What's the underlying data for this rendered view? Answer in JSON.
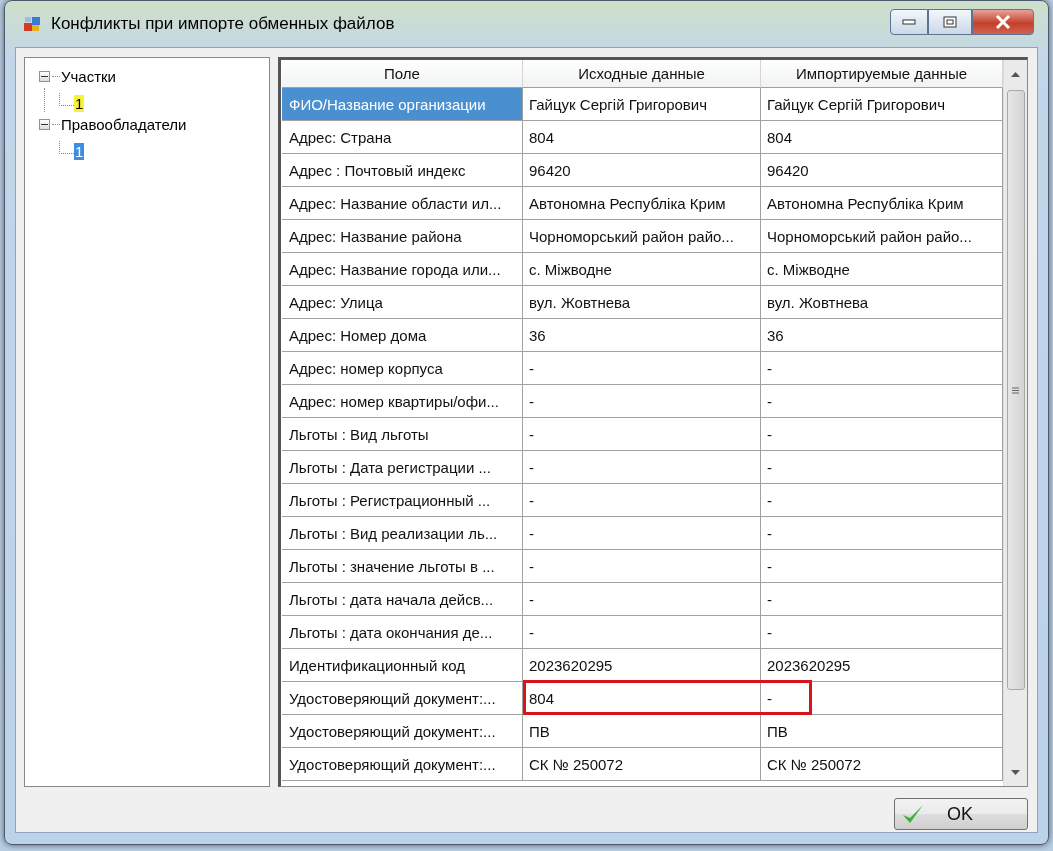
{
  "window": {
    "title": "Конфликты при импорте обменных файлов"
  },
  "tree": [
    {
      "label": "Участки",
      "expanded": true,
      "children": [
        {
          "label": "1",
          "selected": false,
          "highlighted": true
        }
      ]
    },
    {
      "label": "Правообладатели",
      "expanded": true,
      "children": [
        {
          "label": "1",
          "selected": true,
          "highlighted": false
        }
      ]
    }
  ],
  "table": {
    "columns": [
      "Поле",
      "Исходные данные",
      "Импортируемые данные"
    ],
    "rows": [
      {
        "cells": [
          "ФИО/Название организации",
          "Гайцук Сергій Григорович",
          "Гайцук Сергій Григорович"
        ],
        "selected": true,
        "highlighted": false
      },
      {
        "cells": [
          "Адрес: Страна",
          "804",
          "804"
        ],
        "selected": false,
        "highlighted": false
      },
      {
        "cells": [
          "Адрес : Почтовый индекс",
          "96420",
          "96420"
        ],
        "selected": false,
        "highlighted": false
      },
      {
        "cells": [
          "Адрес: Название области ил...",
          "Автономна Республіка Крим",
          "Автономна Республіка Крим"
        ],
        "selected": false,
        "highlighted": false
      },
      {
        "cells": [
          "Адрес: Название района",
          "Чорноморський район райо...",
          "Чорноморський район райо..."
        ],
        "selected": false,
        "highlighted": false
      },
      {
        "cells": [
          "Адрес: Название города или...",
          "с. Міжводне",
          "с. Міжводне"
        ],
        "selected": false,
        "highlighted": false
      },
      {
        "cells": [
          "Адрес: Улица",
          "вул. Жовтнева",
          "вул. Жовтнева"
        ],
        "selected": false,
        "highlighted": false
      },
      {
        "cells": [
          "Адрес: Номер дома",
          "36",
          "36"
        ],
        "selected": false,
        "highlighted": false
      },
      {
        "cells": [
          "Адрес: номер корпуса",
          "-",
          "-"
        ],
        "selected": false,
        "highlighted": false
      },
      {
        "cells": [
          "Адрес: номер квартиры/офи...",
          "-",
          "-"
        ],
        "selected": false,
        "highlighted": false
      },
      {
        "cells": [
          "Льготы : Вид льготы",
          "-",
          "-"
        ],
        "selected": false,
        "highlighted": false
      },
      {
        "cells": [
          "Льготы : Дата регистрации ...",
          "-",
          "-"
        ],
        "selected": false,
        "highlighted": false
      },
      {
        "cells": [
          "Льготы : Регистрационный ...",
          "-",
          "-"
        ],
        "selected": false,
        "highlighted": false
      },
      {
        "cells": [
          "Льготы : Вид реализации ль...",
          "-",
          "-"
        ],
        "selected": false,
        "highlighted": false
      },
      {
        "cells": [
          "Льготы : значение льготы в ...",
          "-",
          "-"
        ],
        "selected": false,
        "highlighted": false
      },
      {
        "cells": [
          "Льготы : дата  начала дейсв...",
          "-",
          "-"
        ],
        "selected": false,
        "highlighted": false
      },
      {
        "cells": [
          "Льготы : дата окончания де...",
          "-",
          "-"
        ],
        "selected": false,
        "highlighted": false
      },
      {
        "cells": [
          "Идентификационный код",
          "2023620295",
          "2023620295"
        ],
        "selected": false,
        "highlighted": false
      },
      {
        "cells": [
          "Удостоверяющий документ:...",
          "804",
          "-"
        ],
        "selected": false,
        "highlighted": true
      },
      {
        "cells": [
          "Удостоверяющий документ:...",
          "ПВ",
          "ПВ"
        ],
        "selected": false,
        "highlighted": false
      },
      {
        "cells": [
          "Удостоверяющий документ:...",
          "СК № 250072",
          "СК № 250072"
        ],
        "selected": false,
        "highlighted": false
      }
    ]
  },
  "buttons": [
    {
      "label": "OK"
    }
  ]
}
